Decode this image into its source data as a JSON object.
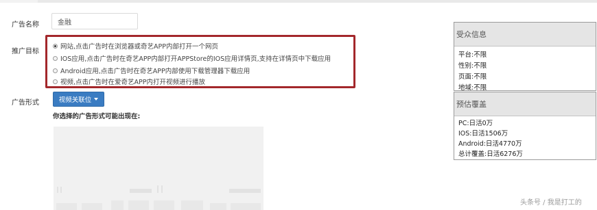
{
  "form": {
    "name_label": "广告名称",
    "name_value": "金融",
    "target_label": "推广目标",
    "target_options": [
      {
        "label": "网站,点击广告时在浏览器或奇艺APP内部打开一个网页",
        "checked": true
      },
      {
        "label": "IOS应用,点击广告时在奇艺APP内部打开APPStore的IOS应用详情页,支持在详情页中下载应用",
        "checked": false
      },
      {
        "label": "Android应用,点击广告时在奇艺APP内部使用下载管理器下载应用",
        "checked": false
      },
      {
        "label": "视频,点击广告时在爱奇艺APP内打开视频进行播放",
        "checked": false
      }
    ],
    "format_label": "广告形式",
    "format_button": "视频关联位",
    "placement_label": "你选择的广告形式可能出现在:"
  },
  "audience_panel": {
    "title": "受众信息",
    "rows": [
      "平台:不限",
      "性别:不限",
      "页面:不限",
      "地域:不限"
    ]
  },
  "estimate_panel": {
    "title": "预估覆盖",
    "rows": [
      "PC:日活0万",
      "IOS:日活1506万",
      "Android:日活4770万",
      "总计覆盖:日活6276万"
    ]
  },
  "watermark": "头条号 / 我是打工的",
  "colors": {
    "highlight_border": "#a3272b",
    "button_bg": "#3a7cc2"
  }
}
